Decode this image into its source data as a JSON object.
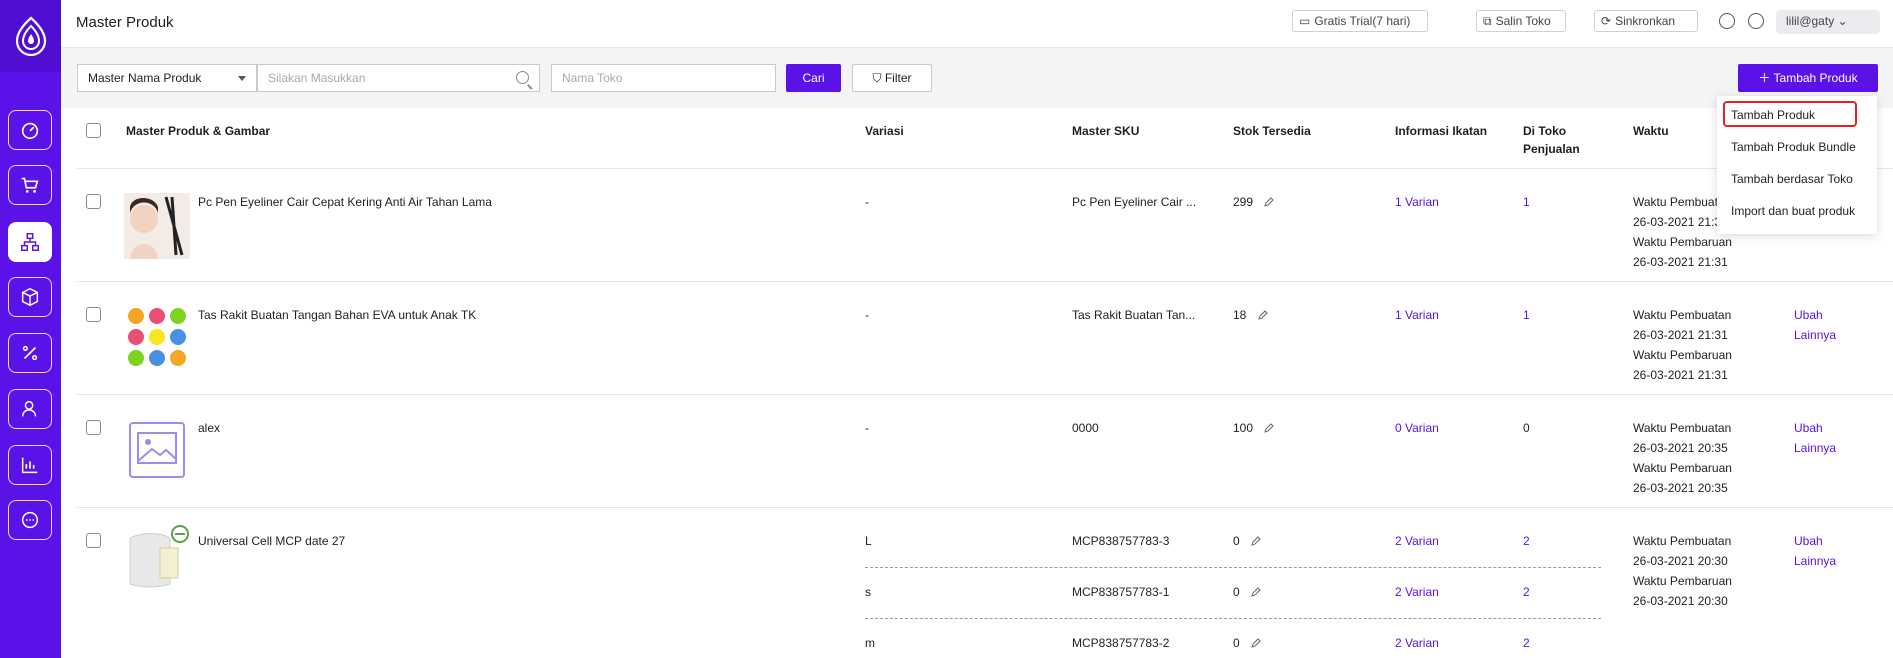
{
  "app": {
    "page_title": "Master Produk"
  },
  "topbar": {
    "trial_label": "Gratis Trial(7 hari)",
    "copy_shop_label": "Salin Toko",
    "sync_label": "Sinkronkan",
    "user_label": "lilil@gaty"
  },
  "filters": {
    "field_select": "Master Nama Produk",
    "search_placeholder": "Silakan Masukkan",
    "shop_placeholder": "Nama Toko",
    "search_button": "Cari",
    "filter_button": "Filter",
    "add_button": "Tambah Produk"
  },
  "dropdown": {
    "items": [
      "Tambah Produk",
      "Tambah Produk Bundle",
      "Tambah berdasar Toko",
      "Import dan buat produk"
    ]
  },
  "table": {
    "headers": {
      "product": "Master Produk & Gambar",
      "variation": "Variasi",
      "sku": "Master SKU",
      "stock": "Stok Tersedia",
      "binding": "Informasi Ikatan",
      "shop_line1": "Di Toko",
      "shop_line2": "Penjualan",
      "time": "Waktu"
    },
    "rows": [
      {
        "name": "Pc Pen Eyeliner Cair Cepat Kering Anti Air Tahan Lama",
        "variation": "-",
        "sku": "Pc Pen Eyeliner Cair ...",
        "stock": "299",
        "binding": "1 Varian",
        "shops": "1",
        "created_label": "Waktu Pembuatan",
        "created": "26-03-2021 21:31",
        "updated_label": "Waktu Pembaruan",
        "updated": "26-03-2021 21:31"
      },
      {
        "name": "Tas Rakit Buatan Tangan Bahan EVA untuk Anak TK",
        "variation": "-",
        "sku": "Tas Rakit Buatan Tan...",
        "stock": "18",
        "binding": "1 Varian",
        "shops": "1",
        "created_label": "Waktu Pembuatan",
        "created": "26-03-2021 21:31",
        "updated_label": "Waktu Pembaruan",
        "updated": "26-03-2021 21:31",
        "edit": "Ubah",
        "more": "Lainnya"
      },
      {
        "name": "alex",
        "variation": "-",
        "sku": "0000",
        "stock": "100",
        "binding": "0 Varian",
        "shops": "0",
        "created_label": "Waktu Pembuatan",
        "created": "26-03-2021 20:35",
        "updated_label": "Waktu Pembaruan",
        "updated": "26-03-2021 20:35",
        "edit": "Ubah",
        "more": "Lainnya"
      },
      {
        "name": "Universal Cell MCP date 27",
        "variants": [
          {
            "variation": "L",
            "sku": "MCP838757783-3",
            "stock": "0",
            "binding": "2 Varian",
            "shops": "2"
          },
          {
            "variation": "s",
            "sku": "MCP838757783-1",
            "stock": "0",
            "binding": "2 Varian",
            "shops": "2"
          },
          {
            "variation": "m",
            "sku": "MCP838757783-2",
            "stock": "0",
            "binding": "2 Varian",
            "shops": "2"
          }
        ],
        "created_label": "Waktu Pembuatan",
        "created": "26-03-2021 20:30",
        "updated_label": "Waktu Pembaruan",
        "updated": "26-03-2021 20:30",
        "edit": "Ubah",
        "more": "Lainnya"
      }
    ]
  },
  "colors": {
    "brand": "#5b12e8",
    "highlight": "#e02424"
  },
  "sidebar": {
    "icons": [
      "dashboard-icon",
      "cart-icon",
      "product-tree-icon",
      "box-icon",
      "discount-icon",
      "customer-icon",
      "chart-icon",
      "chat-icon"
    ]
  }
}
